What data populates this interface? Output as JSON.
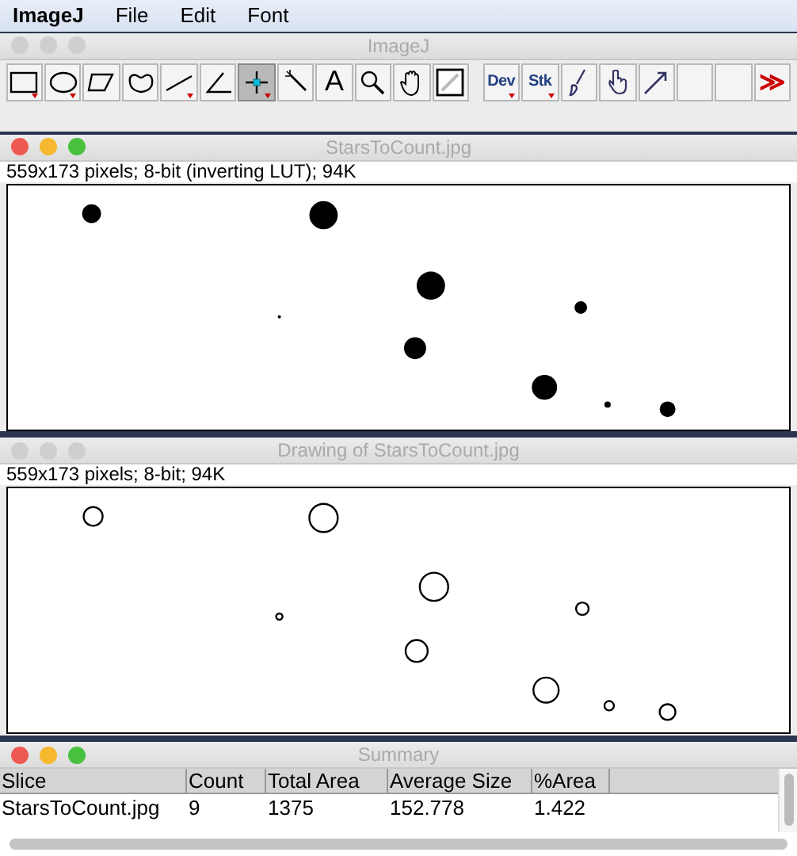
{
  "menu_bar": {
    "app": "ImageJ",
    "items": [
      "File",
      "Edit",
      "Font"
    ]
  },
  "toolbar_window": {
    "title": "ImageJ",
    "tools": [
      {
        "kind": "rectangle",
        "selected": false,
        "has_menu": true
      },
      {
        "kind": "oval",
        "selected": false,
        "has_menu": true
      },
      {
        "kind": "polygon",
        "selected": false,
        "has_menu": false
      },
      {
        "kind": "freehand",
        "selected": false,
        "has_menu": false
      },
      {
        "kind": "line",
        "selected": false,
        "has_menu": true
      },
      {
        "kind": "angle",
        "selected": false,
        "has_menu": false
      },
      {
        "kind": "point",
        "selected": true,
        "has_menu": true
      },
      {
        "kind": "wand",
        "selected": false,
        "has_menu": false
      },
      {
        "kind": "text",
        "label": "A",
        "selected": false,
        "has_menu": false
      },
      {
        "kind": "magnifier",
        "selected": false,
        "has_menu": false
      },
      {
        "kind": "hand",
        "selected": false,
        "has_menu": false
      },
      {
        "kind": "dropper",
        "selected": false,
        "has_menu": false
      },
      {
        "kind": "label",
        "label": "Dev",
        "selected": false,
        "has_menu": true
      },
      {
        "kind": "label",
        "label": "Stk",
        "selected": false,
        "has_menu": true
      },
      {
        "kind": "brush",
        "selected": false,
        "has_menu": false
      },
      {
        "kind": "flood",
        "selected": false,
        "has_menu": false
      },
      {
        "kind": "arrow",
        "selected": false,
        "has_menu": false
      },
      {
        "kind": "empty",
        "selected": false,
        "has_menu": false
      },
      {
        "kind": "empty",
        "selected": false,
        "has_menu": false
      },
      {
        "kind": "more",
        "label": "≫",
        "selected": false,
        "has_menu": false
      }
    ]
  },
  "image_windows": [
    {
      "title": "StarsToCount.jpg",
      "active": true,
      "info": "559x173 pixels; 8-bit (inverting LUT); 94K"
    },
    {
      "title": "Drawing of StarsToCount.jpg",
      "active": false,
      "info": "559x173 pixels; 8-bit; 94K"
    }
  ],
  "summary_window": {
    "title": "Summary",
    "active": true,
    "table": {
      "columns": [
        "Slice",
        "Count",
        "Total Area",
        "Average Size",
        "%Area"
      ],
      "rows": [
        [
          "StarsToCount.jpg",
          "9",
          "1375",
          "152.778",
          "1.422"
        ]
      ]
    }
  }
}
